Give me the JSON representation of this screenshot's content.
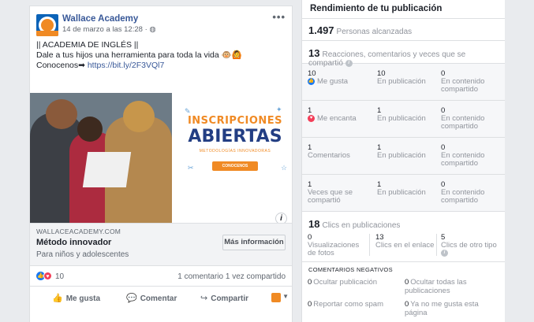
{
  "post": {
    "page_name": "Wallace Academy",
    "date": "14 de marzo a las 12:28 · ",
    "globe_icon": "globe-icon",
    "more": "•••",
    "line1": "|| ACADEMIA DE INGLÉS ||",
    "line2": "Dale a tus hijos una herramienta para toda la vida 🐵🙆",
    "line3_prefix": "Conocenos➡ ",
    "line3_link": "https://bit.ly/2F3VQl7",
    "image": {
      "sign_line1": "INSCRIPCIONES",
      "sign_line2": "ABIERTAS",
      "sign_line3": "METODOLOGÍAS INNOVADORAS",
      "sign_cta": "CONOCENOS"
    },
    "link_domain": "WALLACEACADEMY.COM",
    "link_title": "Método innovador",
    "link_desc": "Para niños y adolescentes",
    "link_button": "Más información",
    "reaction_count": "10",
    "comments_shares": "1 comentario  1 vez compartido",
    "actions": {
      "like": "Me gusta",
      "comment": "Comentar",
      "share": "Compartir"
    }
  },
  "panel": {
    "title": "Rendimiento de tu publicación",
    "reach_value": "1.497",
    "reach_label": "Personas alcanzadas",
    "reactions_value": "13",
    "reactions_label": "Reacciones, comentarios y veces que se compartió",
    "rows": [
      {
        "c1v": "10",
        "c1l": "Me gusta",
        "c2v": "10",
        "c2l": "En publicación",
        "c3v": "0",
        "c3l": "En contenido compartido"
      },
      {
        "c1v": "1",
        "c1l": "Me encanta",
        "c2v": "1",
        "c2l": "En publicación",
        "c3v": "0",
        "c3l": "En contenido compartido"
      },
      {
        "c1v": "1",
        "c1l": "Comentarios",
        "c2v": "1",
        "c2l": "En publicación",
        "c3v": "0",
        "c3l": "En contenido compartido"
      },
      {
        "c1v": "1",
        "c1l": "Veces que se compartió",
        "c2v": "1",
        "c2l": "En publicación",
        "c3v": "0",
        "c3l": "En contenido compartido"
      }
    ],
    "clicks_value": "18",
    "clicks_label": "Clics en publicaciones",
    "clicks": [
      {
        "v": "0",
        "l": "Visualizaciones de fotos"
      },
      {
        "v": "13",
        "l": "Clics en el enlace"
      },
      {
        "v": "5",
        "l": "Clics de otro tipo"
      }
    ],
    "negative_title": "COMENTARIOS NEGATIVOS",
    "negative": [
      {
        "v": "0",
        "l": "Ocultar publicación"
      },
      {
        "v": "0",
        "l": "Ocultar todas las publicaciones"
      },
      {
        "v": "0",
        "l": "Reportar como spam"
      },
      {
        "v": "0",
        "l": "Ya no me gusta esta página"
      }
    ]
  }
}
